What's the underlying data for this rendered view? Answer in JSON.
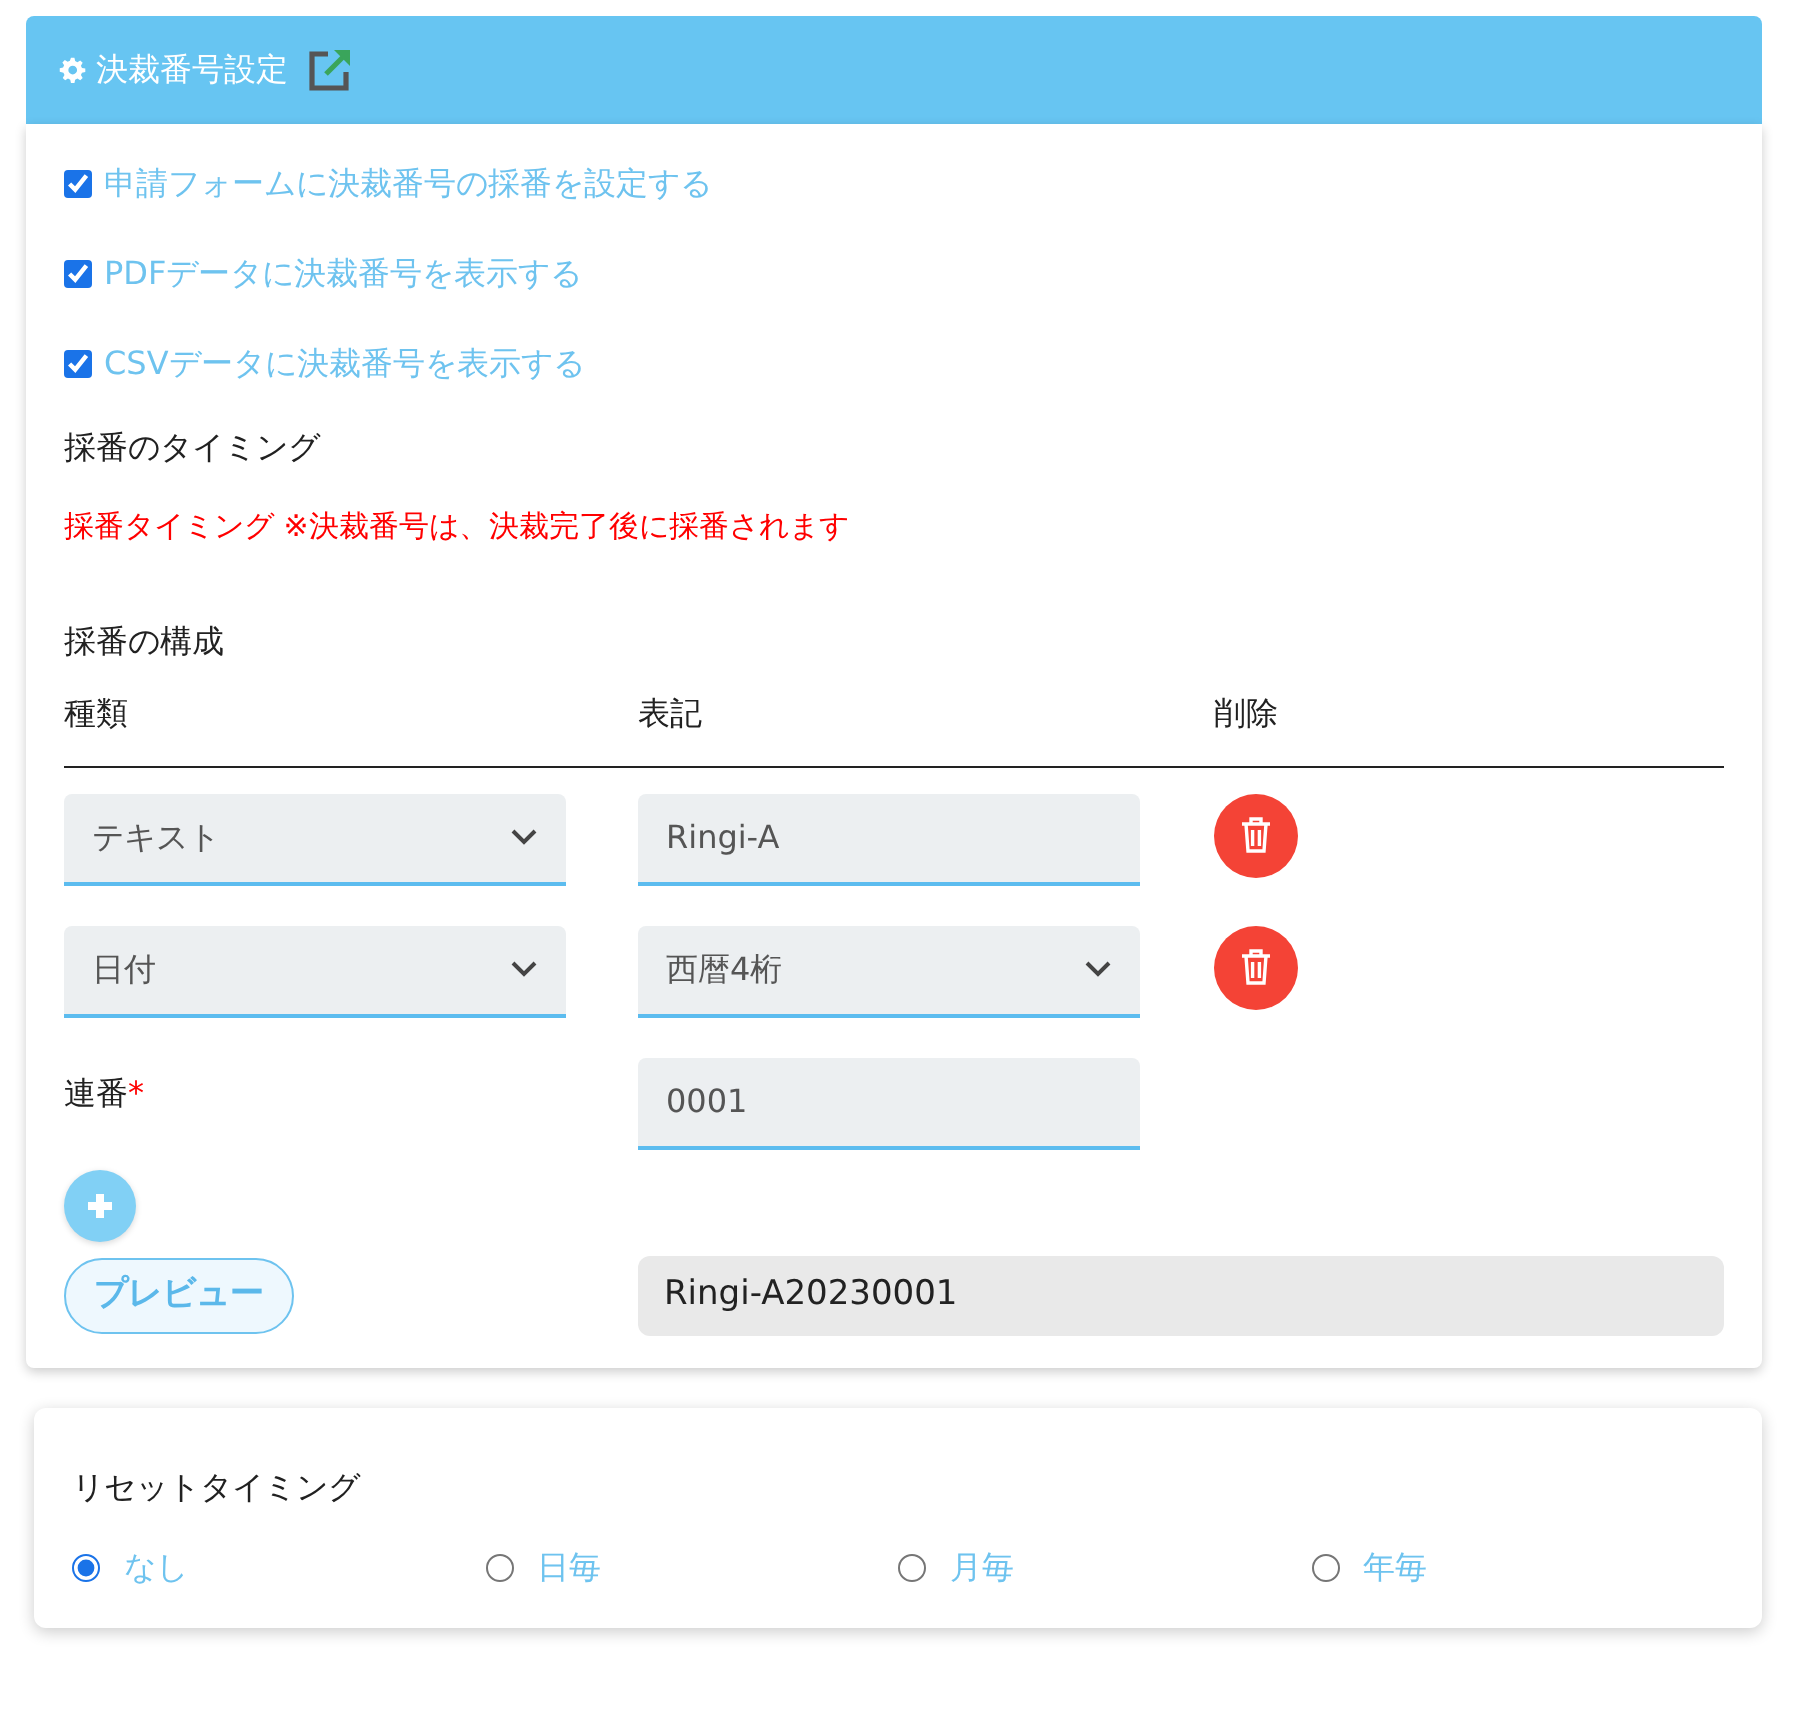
{
  "header": {
    "title": "決裁番号設定"
  },
  "checkboxes": [
    {
      "label": "申請フォームに決裁番号の採番を設定する",
      "checked": true
    },
    {
      "label": "PDFデータに決裁番号を表示する",
      "checked": true
    },
    {
      "label": "CSVデータに決裁番号を表示する",
      "checked": true
    }
  ],
  "timing": {
    "heading": "採番のタイミング",
    "note": "採番タイミング ※決裁番号は、決裁完了後に採番されます"
  },
  "composition": {
    "heading": "採番の構成",
    "columns": [
      "種類",
      "表記",
      "削除"
    ],
    "rows": [
      {
        "type": "テキスト",
        "kind": "input",
        "notation": "Ringi-A"
      },
      {
        "type": "日付",
        "kind": "select",
        "notation": "西暦4桁"
      }
    ],
    "serial": {
      "label": "連番",
      "required_mark": "*",
      "value": "0001"
    },
    "preview": {
      "button": "プレビュー",
      "value": "Ringi-A20230001"
    }
  },
  "reset": {
    "heading": "リセットタイミング",
    "options": [
      {
        "label": "なし",
        "selected": true
      },
      {
        "label": "日毎",
        "selected": false
      },
      {
        "label": "月毎",
        "selected": false
      },
      {
        "label": "年毎",
        "selected": false
      }
    ]
  }
}
